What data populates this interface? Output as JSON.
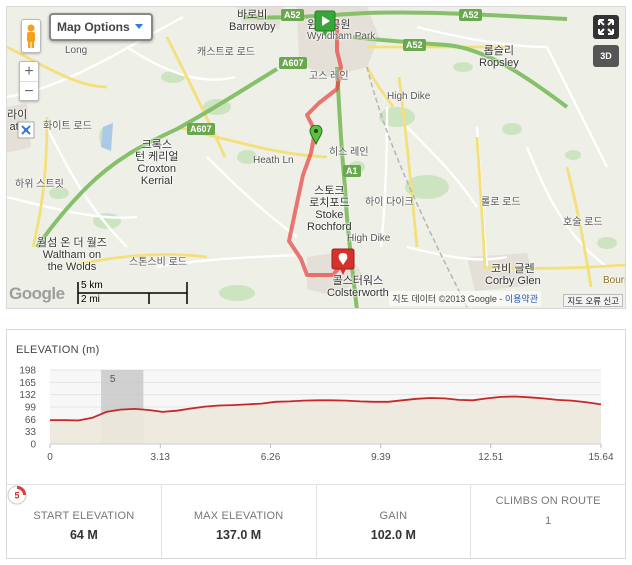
{
  "map": {
    "options_label": "Map Options",
    "btn3d_label": "3D",
    "google_logo": "Google",
    "scale": {
      "km": "5 km",
      "mi": "2 mi"
    },
    "copyright": "지도 데이터 ©2013 Google",
    "copyright_sep": " - ",
    "terms_link": "이용약관",
    "report_label": "지도 오류 신고",
    "roads": [
      "A52",
      "A52",
      "A52",
      "A607",
      "A607",
      "A1"
    ],
    "places": {
      "barrowby": "Barrowby",
      "barrowby_ko": "바로비",
      "wyndham": "Wyndham",
      "wyndham_park": "Park",
      "wyndham_ko": "윈덤 공원",
      "ropsley_ko": "롭슬리",
      "ropsley": "Ropsley",
      "croxton_ko1": "크록스",
      "croxton_ko2": "턴 케리얼",
      "croxton": "Croxton",
      "kerrial": "Kerrial",
      "stoke_ko1": "스토크",
      "stoke_ko2": "로치포드",
      "stoke": "Stoke",
      "rochford": "Rochford",
      "waltham_ko": "월섬 온 더 월즈",
      "waltham": "Waltham on",
      "wolds": "the Wolds",
      "corby_ko": "코비 글렌",
      "corby": "Corby Glen",
      "colster_ko": "콜스터워스",
      "colster": "Colsterworth",
      "heath_ln": "Heath Ln",
      "heath_ko": "히스 레인",
      "gosse_ko": "고스 레인",
      "longlane": "Long",
      "highdike": "High Dike",
      "highdike_ko": "하이 다이크",
      "highdike2": "High Dike",
      "stsh_ko": "스톤스비 로드",
      "left_ko": "라이",
      "left_en": "ath",
      "ko_road1": "캐스트로 로드",
      "ko_road2": "화이트 로드",
      "ko_road3": "하위 스트릿",
      "ko_road4": "롤로 로드",
      "ko_road5": "호술 로드",
      "bourne": "Bourn"
    }
  },
  "elevation": {
    "title": "ELEVATION (m)",
    "y_ticks": [
      "198",
      "165",
      "132",
      "99",
      "66",
      "33",
      "0"
    ],
    "x_ticks": [
      "0",
      "3.13",
      "6.26",
      "9.39",
      "12.51",
      "15.64"
    ],
    "highlight_label": "5"
  },
  "chart_data": {
    "type": "area",
    "title": "ELEVATION (m)",
    "xlabel": "",
    "ylabel": "",
    "xlim": [
      0,
      15.64
    ],
    "ylim": [
      0,
      198
    ],
    "x": [
      0,
      0.4,
      0.8,
      1.2,
      1.6,
      2.0,
      2.4,
      2.8,
      3.2,
      3.6,
      4.0,
      4.4,
      4.8,
      5.2,
      5.6,
      6.0,
      6.4,
      6.8,
      7.2,
      7.6,
      8.0,
      8.4,
      8.8,
      9.2,
      9.6,
      10.0,
      10.4,
      10.8,
      11.2,
      11.6,
      12.0,
      12.4,
      12.8,
      13.2,
      13.6,
      14.0,
      14.4,
      14.8,
      15.2,
      15.64
    ],
    "series": [
      {
        "values": [
          64,
          64,
          63,
          70,
          86,
          92,
          94,
          91,
          86,
          89,
          95,
          100,
          103,
          104,
          106,
          108,
          113,
          114,
          116,
          117,
          117,
          116,
          114,
          113,
          113,
          117,
          121,
          123,
          122,
          118,
          117,
          122,
          126,
          127,
          125,
          122,
          118,
          116,
          112,
          106
        ]
      }
    ]
  },
  "stats": {
    "start_label": "START ELEVATION",
    "start_value": "64 M",
    "max_label": "MAX ELEVATION",
    "max_value": "137.0 M",
    "gain_label": "GAIN",
    "gain_value": "102.0 M",
    "climbs_label": "CLIMBS ON ROUTE",
    "climbs_badge": "5",
    "climbs_count": "1"
  }
}
